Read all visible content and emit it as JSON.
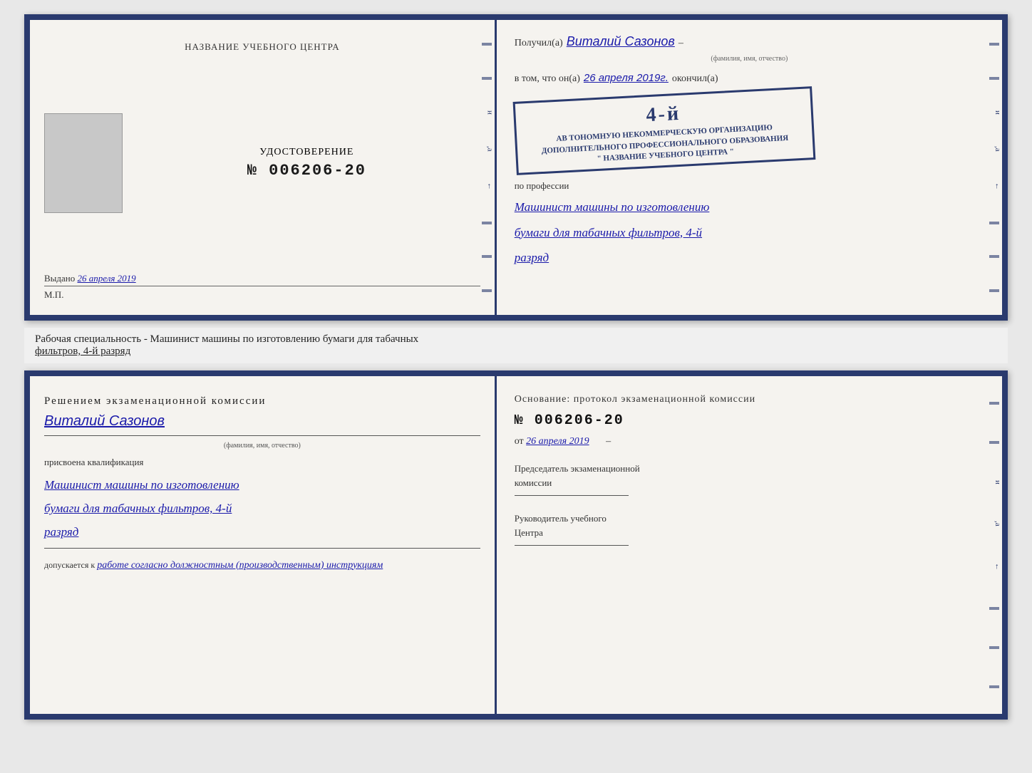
{
  "top_cert": {
    "left": {
      "org_name_label": "НАЗВАНИЕ УЧЕБНОГО ЦЕНТРА",
      "photo_alt": "Фото",
      "udost_label": "УДОСТОВЕРЕНИЕ",
      "udost_number": "№ 006206-20",
      "vydano_label": "Выдано",
      "vydano_date": "26 апреля 2019",
      "mp_label": "М.П."
    },
    "right": {
      "poluchil_prefix": "Получил(а)",
      "recipient_name": "Виталий Сазонов",
      "recipient_subtitle": "(фамилия, имя, отчество)",
      "dash": "–",
      "vtom_prefix": "в том, что он(а)",
      "vtom_date": "26 апреля 2019г.",
      "okonchil": "окончил(а)",
      "stamp_line1": "АВ ТОНОМНУЮ НЕКОММЕРЧЕСКУЮ ОРГАНИЗАЦИЮ",
      "stamp_line2": "ДОПОЛНИТЕЛЬНОГО ПРОФЕССИОНАЛЬНОГО ОБРАЗОВАНИЯ",
      "stamp_line3": "\" НАЗВАНИЕ УЧЕБНОГО ЦЕНТРА \"",
      "stamp_number": "4-й",
      "profession_prefix": "по профессии",
      "profession_line1": "Машинист машины по изготовлению",
      "profession_line2": "бумаги для табачных фильтров, 4-й",
      "profession_line3": "разряд"
    }
  },
  "middle": {
    "text_prefix": "Рабочая специальность - Машинист машины по изготовлению бумаги для табачных",
    "text_underline": "фильтров, 4-й разряд"
  },
  "bottom_cert": {
    "left": {
      "title": "Решением экзаменационной комиссии",
      "name": "Виталий Сазонов",
      "name_sub": "(фамилия, имя, отчество)",
      "prisvoyena": "присвоена квалификация",
      "qual_line1": "Машинист машины по изготовлению",
      "qual_line2": "бумаги для табачных фильтров, 4-й",
      "qual_line3": "разряд",
      "dopuskaetsya_prefix": "допускается к",
      "dopuskaetsya_text": "работе согласно должностным (производственным) инструкциям"
    },
    "right": {
      "osnovanie": "Основание: протокол экзаменационной комиссии",
      "number": "№  006206-20",
      "ot_prefix": "от",
      "ot_date": "26 апреля 2019",
      "predsedatel_line1": "Председатель экзаменационной",
      "predsedatel_line2": "комиссии",
      "rukovoditel_line1": "Руководитель учебного",
      "rukovoditel_line2": "Центра"
    }
  }
}
